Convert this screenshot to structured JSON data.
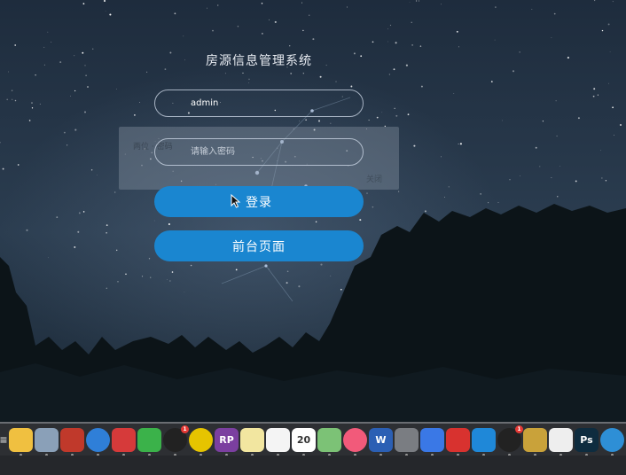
{
  "login": {
    "title": "房源信息管理系统",
    "username_value": "admin",
    "password_placeholder": "请输入密码",
    "login_button": "登录",
    "frontpage_button": "前台页面",
    "overlay_hint": "两位 · 密码",
    "overlay_hint_right": "关闭"
  },
  "dock": {
    "items": [
      {
        "name": "menu",
        "label": "≡",
        "color": "#2d2f33"
      },
      {
        "name": "sequel",
        "label": "",
        "color": "#f0c040"
      },
      {
        "name": "database",
        "label": "",
        "color": "#8aa0b8"
      },
      {
        "name": "redis",
        "label": "",
        "color": "#c0392b"
      },
      {
        "name": "safari",
        "label": "",
        "color": "#2f7fd8"
      },
      {
        "name": "screen",
        "label": "",
        "color": "#d63a3a"
      },
      {
        "name": "wechat",
        "label": "",
        "color": "#3bb24a"
      },
      {
        "name": "qq",
        "label": "",
        "color": "#222222",
        "badge": "1"
      },
      {
        "name": "music",
        "label": "",
        "color": "#e6c400"
      },
      {
        "name": "axure",
        "label": "RP",
        "color": "#7b3fa0"
      },
      {
        "name": "notes",
        "label": "",
        "color": "#f2e6a0"
      },
      {
        "name": "reminders",
        "label": "",
        "color": "#f4f4f4"
      },
      {
        "name": "calendar",
        "label": "20",
        "color": "#ffffff"
      },
      {
        "name": "maps",
        "label": "",
        "color": "#7cc276"
      },
      {
        "name": "itunes",
        "label": "",
        "color": "#f25a7a"
      },
      {
        "name": "word",
        "label": "W",
        "color": "#2b5fb4"
      },
      {
        "name": "prefs",
        "label": "",
        "color": "#7a7d82"
      },
      {
        "name": "baidu",
        "label": "",
        "color": "#3a78e6"
      },
      {
        "name": "parallels",
        "label": "",
        "color": "#d8322f"
      },
      {
        "name": "teamviewer",
        "label": "",
        "color": "#1f88d8"
      },
      {
        "name": "qq2",
        "label": "",
        "color": "#222222",
        "badge": "1"
      },
      {
        "name": "archive",
        "label": "",
        "color": "#c9a23a"
      },
      {
        "name": "textedit",
        "label": "",
        "color": "#eeeeee"
      },
      {
        "name": "photoshop",
        "label": "Ps",
        "color": "#0e2c3f"
      },
      {
        "name": "edge",
        "label": "",
        "color": "#2e8fd6"
      }
    ]
  },
  "colors": {
    "button": "#1a86d0",
    "sky_top": "#1e2c3d",
    "sky_bottom": "#2b3d50",
    "trees": "#0c1418"
  }
}
